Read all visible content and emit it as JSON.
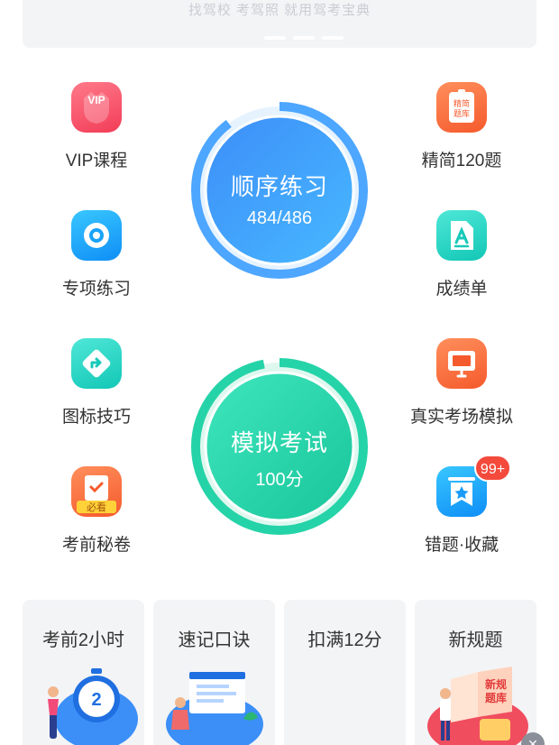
{
  "banner": {
    "text": "找驾校 考驾照 就用驾考宝典"
  },
  "features": {
    "vip": {
      "label": "VIP课程",
      "icon": "vip-crown-icon",
      "icon_text": "VIP"
    },
    "jingjian": {
      "label": "精简120题",
      "icon": "document-icon",
      "icon_text": "精简题库"
    },
    "zhuanxiang": {
      "label": "专项练习",
      "icon": "target-icon"
    },
    "chengji": {
      "label": "成绩单",
      "icon": "report-icon"
    },
    "tubiao": {
      "label": "图标技巧",
      "icon": "road-sign-icon"
    },
    "zhenshi": {
      "label": "真实考场模拟",
      "icon": "monitor-icon"
    },
    "kaoqian": {
      "label": "考前秘卷",
      "icon": "exam-paper-icon",
      "icon_text": "必看"
    },
    "cuoti": {
      "label": "错题·收藏",
      "icon": "bookmark-star-icon",
      "badge": "99+"
    }
  },
  "practice": {
    "title": "顺序练习",
    "progress_text": "484/486",
    "done": 484,
    "total": 486,
    "color_start": "#3d8ef8",
    "color_end": "#47b8ff"
  },
  "exam": {
    "title": "模拟考试",
    "score_text": "100分",
    "fraction": 0.97,
    "color_start": "#36e0b7",
    "color_end": "#1ec99a"
  },
  "cards": [
    {
      "title": "考前2小时",
      "icon": "stopwatch-icon",
      "icon_text": "2"
    },
    {
      "title": "速记口诀",
      "icon": "reading-person-icon"
    },
    {
      "title": "扣满12分",
      "icon": ""
    },
    {
      "title": "新规题",
      "icon": "open-book-icon",
      "icon_text": "新规题库"
    }
  ],
  "close": {
    "icon": "close-icon",
    "glyph": "✕"
  }
}
